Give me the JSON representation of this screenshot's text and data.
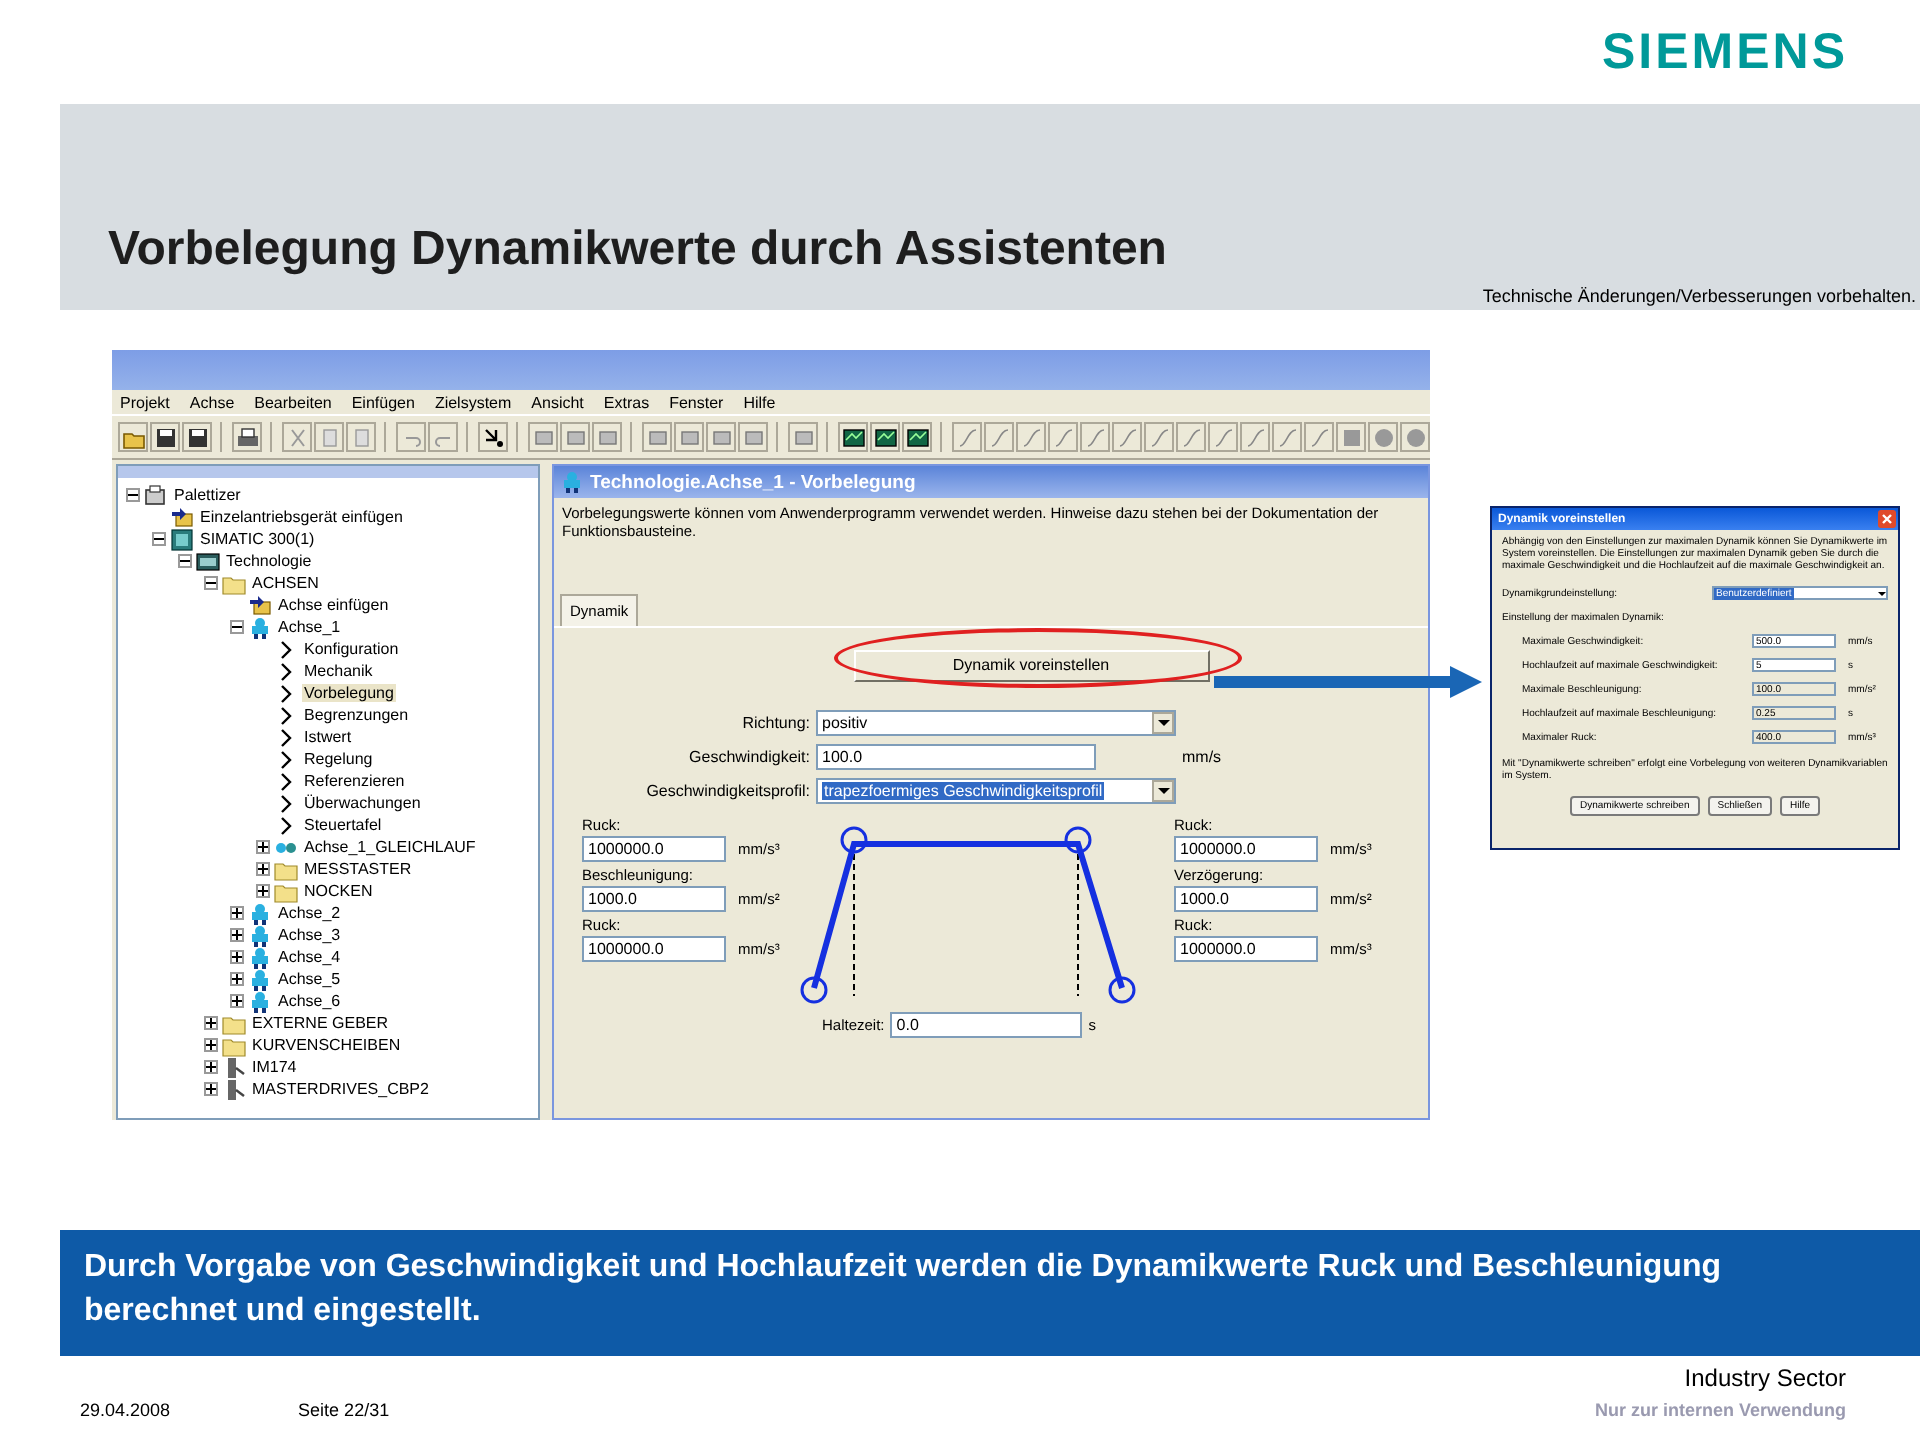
{
  "header": {
    "logo": "SIEMENS",
    "title": "Vorbelegung Dynamikwerte durch Assistenten",
    "notice": "Technische Änderungen/Verbesserungen vorbehalten."
  },
  "app": {
    "menu": [
      "Projekt",
      "Achse",
      "Bearbeiten",
      "Einfügen",
      "Zielsystem",
      "Ansicht",
      "Extras",
      "Fenster",
      "Hilfe"
    ],
    "tree": [
      {
        "label": "Palettizer",
        "kind": "project",
        "selected": false,
        "expanded": true,
        "children": [
          {
            "label": "Einzelantriebsgerät einfügen",
            "kind": "insert",
            "selected": false
          },
          {
            "label": "SIMATIC 300(1)",
            "kind": "station",
            "selected": false,
            "expanded": true,
            "children": [
              {
                "label": "Technologie",
                "kind": "technology",
                "selected": false,
                "expanded": true,
                "children": [
                  {
                    "label": "ACHSEN",
                    "kind": "folder",
                    "selected": false,
                    "expanded": true,
                    "children": [
                      {
                        "label": "Achse einfügen",
                        "kind": "insert",
                        "selected": false
                      },
                      {
                        "label": "Achse_1",
                        "kind": "axis",
                        "selected": false,
                        "expanded": true,
                        "children": [
                          {
                            "label": "Konfiguration",
                            "kind": "param",
                            "selected": false
                          },
                          {
                            "label": "Mechanik",
                            "kind": "param",
                            "selected": false
                          },
                          {
                            "label": "Vorbelegung",
                            "kind": "param",
                            "selected": true
                          },
                          {
                            "label": "Begrenzungen",
                            "kind": "param",
                            "selected": false
                          },
                          {
                            "label": "Istwert",
                            "kind": "param",
                            "selected": false
                          },
                          {
                            "label": "Regelung",
                            "kind": "param",
                            "selected": false
                          },
                          {
                            "label": "Referenzieren",
                            "kind": "param",
                            "selected": false
                          },
                          {
                            "label": "Überwachungen",
                            "kind": "param",
                            "selected": false
                          },
                          {
                            "label": "Steuertafel",
                            "kind": "param",
                            "selected": false
                          },
                          {
                            "label": "Achse_1_GLEICHLAUF",
                            "kind": "sync",
                            "selected": false,
                            "expanded": false
                          },
                          {
                            "label": "MESSTASTER",
                            "kind": "folder",
                            "selected": false,
                            "expanded": false
                          },
                          {
                            "label": "NOCKEN",
                            "kind": "folder",
                            "selected": false,
                            "expanded": false
                          }
                        ]
                      },
                      {
                        "label": "Achse_2",
                        "kind": "axis",
                        "selected": false,
                        "expanded": false
                      },
                      {
                        "label": "Achse_3",
                        "kind": "axis",
                        "selected": false,
                        "expanded": false
                      },
                      {
                        "label": "Achse_4",
                        "kind": "axis",
                        "selected": false,
                        "expanded": false
                      },
                      {
                        "label": "Achse_5",
                        "kind": "axis",
                        "selected": false,
                        "expanded": false
                      },
                      {
                        "label": "Achse_6",
                        "kind": "axis",
                        "selected": false,
                        "expanded": false
                      }
                    ]
                  },
                  {
                    "label": "EXTERNE GEBER",
                    "kind": "folder",
                    "selected": false,
                    "expanded": false
                  },
                  {
                    "label": "KURVENSCHEIBEN",
                    "kind": "folder",
                    "selected": false,
                    "expanded": false
                  },
                  {
                    "label": "IM174",
                    "kind": "device",
                    "selected": false,
                    "expanded": false
                  },
                  {
                    "label": "MASTERDRIVES_CBP2",
                    "kind": "device",
                    "selected": false,
                    "expanded": false
                  }
                ]
              }
            ]
          }
        ]
      }
    ],
    "dialog": {
      "title": "Technologie.Achse_1 - Vorbelegung",
      "description": "Vorbelegungswerte können vom Anwenderprogramm verwendet werden. Hinweise dazu stehen bei der Dokumentation der Funktionsbausteine.",
      "tabs": [
        {
          "label": "Dynamik",
          "selected": true
        }
      ],
      "preset_button": "Dynamik voreinstellen",
      "direction": {
        "label": "Richtung:",
        "value": "positiv"
      },
      "speed": {
        "label": "Geschwindigkeit:",
        "value": "100.0",
        "unit": "mm/s"
      },
      "profile": {
        "label": "Geschwindigkeitsprofil:",
        "value": "trapezfoermiges Geschwindigkeitsprofil"
      },
      "left": [
        {
          "label": "Ruck:",
          "value": "1000000.0",
          "unit": "mm/s³"
        },
        {
          "label": "Beschleunigung:",
          "value": "1000.0",
          "unit": "mm/s²"
        },
        {
          "label": "Ruck:",
          "value": "1000000.0",
          "unit": "mm/s³"
        }
      ],
      "right": [
        {
          "label": "Ruck:",
          "value": "1000000.0",
          "unit": "mm/s³"
        },
        {
          "label": "Verzögerung:",
          "value": "1000.0",
          "unit": "mm/s²"
        },
        {
          "label": "Ruck:",
          "value": "1000000.0",
          "unit": "mm/s³"
        }
      ],
      "hold": {
        "label": "Haltezeit:",
        "value": "0.0",
        "unit": "s"
      }
    }
  },
  "popup": {
    "title": "Dynamik voreinstellen",
    "description": "Abhängig von den Einstellungen zur maximalen Dynamik können Sie Dynamikwerte im System voreinstellen. Die Einstellungen zur maximalen Dynamik geben Sie durch die maximale Geschwindigkeit und die Hochlaufzeit auf die maximale Geschwindigkeit an.",
    "preset": {
      "label": "Dynamikgrundeinstellung:",
      "value": "Benutzerdefiniert"
    },
    "section": "Einstellung der maximalen Dynamik:",
    "rows": [
      {
        "label": "Maximale Geschwindigkeit:",
        "value": "500.0",
        "unit": "mm/s",
        "disabled": false
      },
      {
        "label": "Hochlaufzeit auf maximale Geschwindigkeit:",
        "value": "5",
        "unit": "s",
        "disabled": false
      },
      {
        "label": "Maximale Beschleunigung:",
        "value": "100.0",
        "unit": "mm/s²",
        "disabled": true
      },
      {
        "label": "Hochlaufzeit auf maximale Beschleunigung:",
        "value": "0.25",
        "unit": "s",
        "disabled": true
      },
      {
        "label": "Maximaler Ruck:",
        "value": "400.0",
        "unit": "mm/s³",
        "disabled": true
      }
    ],
    "note": "Mit \"Dynamikwerte schreiben\" erfolgt eine Vorbelegung von weiteren Dynamikvariablen im System.",
    "buttons": [
      "Dynamikwerte schreiben",
      "Schließen",
      "Hilfe"
    ]
  },
  "banner": "Durch Vorgabe von Geschwindigkeit und Hochlaufzeit werden die Dynamikwerte Ruck und Beschleunigung berechnet und eingestellt.",
  "footer": {
    "sector": "Industry Sector",
    "date": "29.04.2008",
    "page": "Seite 22/31",
    "classification": "Nur zur internen Verwendung"
  }
}
